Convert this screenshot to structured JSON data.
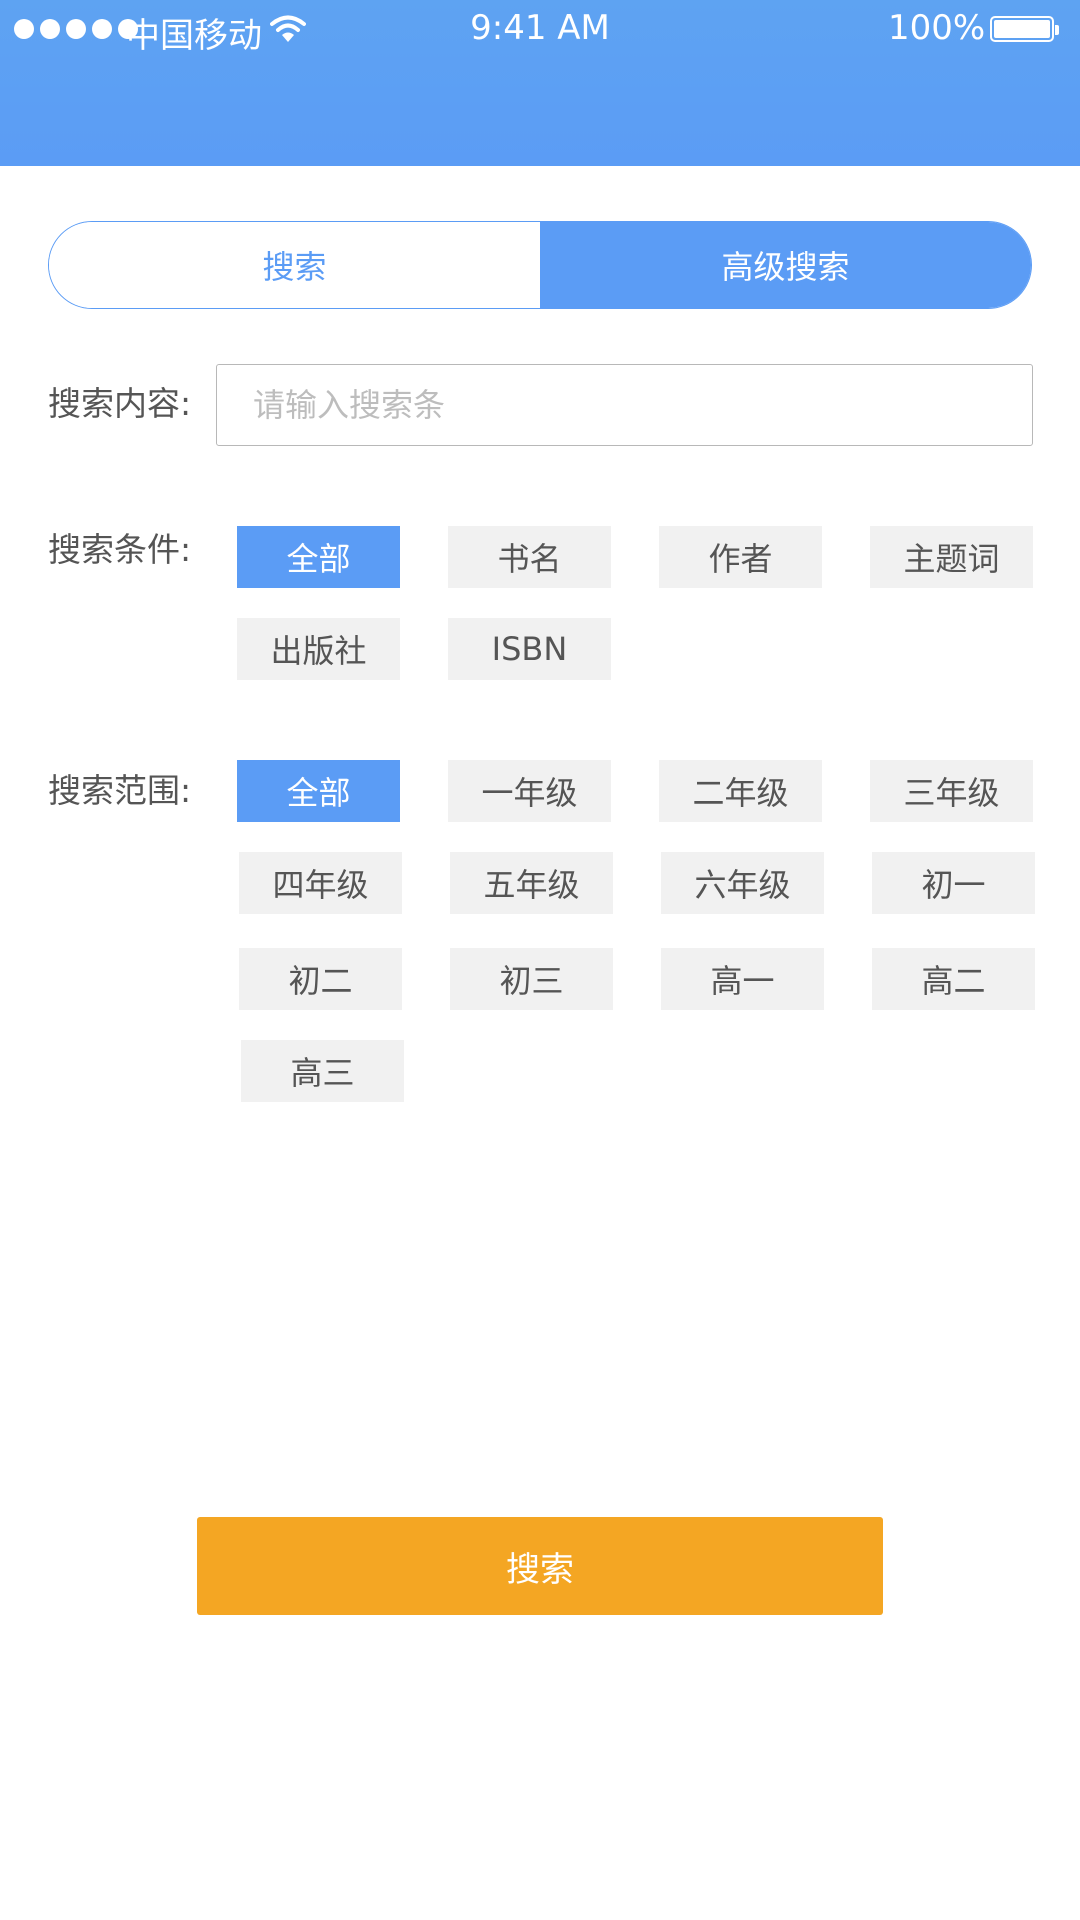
{
  "status_bar": {
    "carrier": "中国移动",
    "time": "9:41 AM",
    "battery": "100%"
  },
  "tabs": [
    {
      "label": "搜索",
      "active": false
    },
    {
      "label": "高级搜索",
      "active": true
    }
  ],
  "search": {
    "label": "搜索内容:",
    "placeholder": "请输入搜索条",
    "value": ""
  },
  "conditions": {
    "label": "搜索条件:",
    "options": [
      "全部",
      "书名",
      "作者",
      "主题词",
      "出版社",
      "ISBN"
    ],
    "selected": "全部"
  },
  "scope": {
    "label": "搜索范围:",
    "options": [
      "全部",
      "一年级",
      "二年级",
      "三年级",
      "四年级",
      "五年级",
      "六年级",
      "初一",
      "初二",
      "初三",
      "高一",
      "高二",
      "高三"
    ],
    "selected": "全部"
  },
  "submit": {
    "label": "搜索"
  },
  "colors": {
    "primary": "#5b9cf5",
    "accent": "#f4a623",
    "chip_bg": "#f1f1f1"
  }
}
